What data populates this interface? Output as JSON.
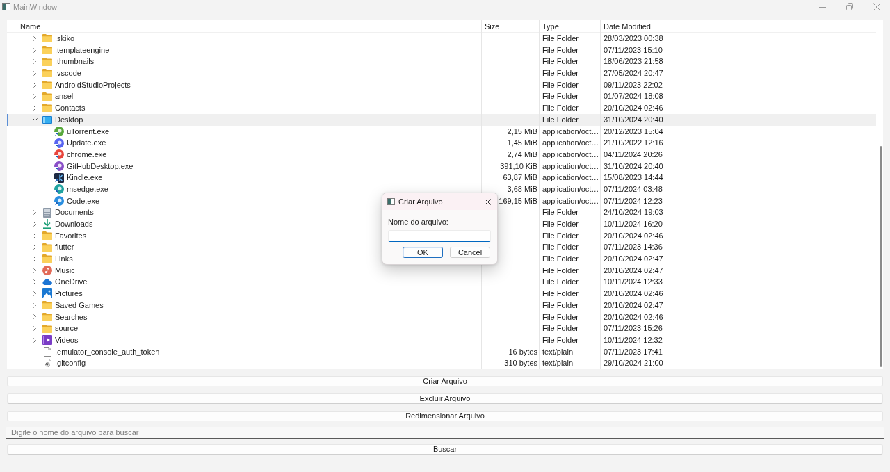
{
  "window": {
    "title": "MainWindow"
  },
  "tree": {
    "columns": [
      "Name",
      "Size",
      "Type",
      "Date Modified"
    ],
    "rows": [
      {
        "name": ".skiko",
        "kind": "folder",
        "type": "File Folder",
        "date_modified": "28/03/2023 00:38",
        "expanded": false,
        "selected": false
      },
      {
        "name": ".templateengine",
        "kind": "folder",
        "type": "File Folder",
        "date_modified": "07/11/2023 15:10",
        "expanded": false,
        "selected": false
      },
      {
        "name": ".thumbnails",
        "kind": "folder",
        "type": "File Folder",
        "date_modified": "18/06/2023 21:58",
        "expanded": false,
        "selected": false
      },
      {
        "name": ".vscode",
        "kind": "folder",
        "type": "File Folder",
        "date_modified": "27/05/2024 20:47",
        "expanded": false,
        "selected": false
      },
      {
        "name": "AndroidStudioProjects",
        "kind": "folder",
        "type": "File Folder",
        "date_modified": "09/11/2023 22:02",
        "expanded": false,
        "selected": false
      },
      {
        "name": "ansel",
        "kind": "folder",
        "type": "File Folder",
        "date_modified": "01/07/2024 18:08",
        "expanded": false,
        "selected": false
      },
      {
        "name": "Contacts",
        "kind": "folder",
        "type": "File Folder",
        "date_modified": "20/10/2024 02:46",
        "expanded": false,
        "selected": false
      },
      {
        "name": "Desktop",
        "kind": "desktop",
        "type": "File Folder",
        "date_modified": "31/10/2024 20:40",
        "expanded": true,
        "selected": true,
        "children": [
          {
            "name": "uTorrent.exe",
            "kind": "app",
            "color": "#58a83c",
            "size": "2,15 MiB",
            "type": "application/oct…",
            "date_modified": "20/12/2023 15:04",
            "selected": false
          },
          {
            "name": "Update.exe",
            "kind": "app",
            "color": "#5865f2",
            "size": "1,45 MiB",
            "type": "application/oct…",
            "date_modified": "21/10/2022 12:16",
            "selected": false
          },
          {
            "name": "chrome.exe",
            "kind": "app",
            "color": "#e8453c",
            "size": "2,74 MiB",
            "type": "application/oct…",
            "date_modified": "04/11/2024 20:26",
            "selected": false
          },
          {
            "name": "GitHubDesktop.exe",
            "kind": "app",
            "color": "#8a4fc8",
            "size": "391,10 KiB",
            "type": "application/oct…",
            "date_modified": "31/10/2024 20:40",
            "selected": false
          },
          {
            "name": "Kindle.exe",
            "kind": "tile",
            "color": "#1d2a44",
            "size": "63,87 MiB",
            "type": "application/oct…",
            "date_modified": "15/08/2023 14:44",
            "selected": false
          },
          {
            "name": "msedge.exe",
            "kind": "app",
            "color": "#1fa3a0",
            "size": "3,68 MiB",
            "type": "application/oct…",
            "date_modified": "07/11/2024 03:48",
            "selected": false
          },
          {
            "name": "Code.exe",
            "kind": "app",
            "color": "#2a8ee0",
            "size": "169,15 MiB",
            "type": "application/oct…",
            "date_modified": "07/11/2024 12:23",
            "selected": false
          }
        ]
      },
      {
        "name": "Documents",
        "kind": "documents",
        "type": "File Folder",
        "date_modified": "24/10/2024 19:03",
        "expanded": false,
        "selected": false
      },
      {
        "name": "Downloads",
        "kind": "downloads",
        "type": "File Folder",
        "date_modified": "10/11/2024 16:20",
        "expanded": false,
        "selected": false
      },
      {
        "name": "Favorites",
        "kind": "folder",
        "type": "File Folder",
        "date_modified": "20/10/2024 02:46",
        "expanded": false,
        "selected": false
      },
      {
        "name": "flutter",
        "kind": "folder",
        "type": "File Folder",
        "date_modified": "07/11/2023 14:36",
        "expanded": false,
        "selected": false
      },
      {
        "name": "Links",
        "kind": "folder",
        "type": "File Folder",
        "date_modified": "20/10/2024 02:47",
        "expanded": false,
        "selected": false
      },
      {
        "name": "Music",
        "kind": "music",
        "type": "File Folder",
        "date_modified": "20/10/2024 02:47",
        "expanded": false,
        "selected": false
      },
      {
        "name": "OneDrive",
        "kind": "cloud",
        "type": "File Folder",
        "date_modified": "10/11/2024 12:33",
        "expanded": false,
        "selected": false
      },
      {
        "name": "Pictures",
        "kind": "pictures",
        "type": "File Folder",
        "date_modified": "20/10/2024 02:46",
        "expanded": false,
        "selected": false
      },
      {
        "name": "Saved Games",
        "kind": "folder",
        "type": "File Folder",
        "date_modified": "20/10/2024 02:47",
        "expanded": false,
        "selected": false
      },
      {
        "name": "Searches",
        "kind": "folder",
        "type": "File Folder",
        "date_modified": "20/10/2024 02:46",
        "expanded": false,
        "selected": false
      },
      {
        "name": "source",
        "kind": "folder",
        "type": "File Folder",
        "date_modified": "07/11/2023 15:26",
        "expanded": false,
        "selected": false
      },
      {
        "name": "Videos",
        "kind": "videos",
        "type": "File Folder",
        "date_modified": "10/11/2024 12:32",
        "expanded": false,
        "selected": false
      },
      {
        "name": ".emulator_console_auth_token",
        "kind": "file",
        "size": "16 bytes",
        "type": "text/plain",
        "date_modified": "07/11/2023 17:41",
        "selected": false
      },
      {
        "name": ".gitconfig",
        "kind": "config",
        "size": "310 bytes",
        "type": "text/plain",
        "date_modified": "29/10/2024 21:00",
        "selected": false
      }
    ]
  },
  "actions": [
    {
      "label": "Criar Arquivo"
    },
    {
      "label": "Excluir Arquivo"
    },
    {
      "label": "Redimensionar Arquivo"
    }
  ],
  "search": {
    "placeholder": "Digite o nome do arquivo para buscar"
  },
  "search_button": {
    "label": "Buscar"
  },
  "dialog": {
    "title": "Criar Arquivo",
    "label": "Nome do arquivo:",
    "buttons": [
      {
        "label": "OK",
        "default": true
      },
      {
        "label": "Cancel",
        "default": false
      }
    ]
  }
}
